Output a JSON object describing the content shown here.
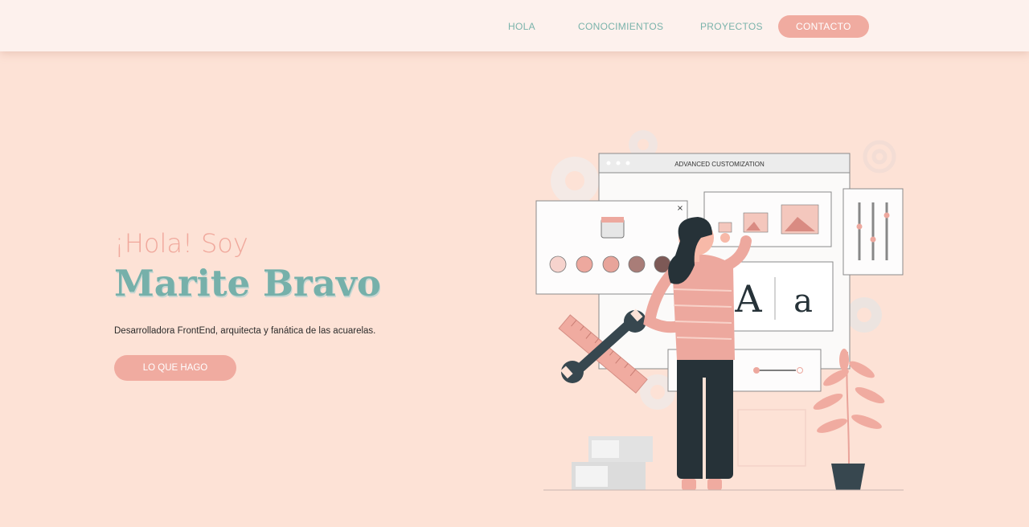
{
  "nav": {
    "items": [
      "HOLA",
      "CONOCIMIENTOS",
      "PROYECTOS"
    ],
    "contact_label": "CONTACTO"
  },
  "hero": {
    "greeting": "¡Hola! Soy",
    "name": "Marite Bravo",
    "description": "Desarrolladora FrontEnd, arquitecta y fanática de las acuarelas.",
    "button_label": "LO QUE HAGO"
  },
  "illustration": {
    "window_title": "ADVANCED CUSTOMIZATION",
    "font_sample_upper": "A",
    "font_sample_lower": "a",
    "close_glyph": "×"
  },
  "colors": {
    "background": "#fde2d6",
    "header": "#fdf1ed",
    "accent_pink": "#f0aba0",
    "accent_teal": "#76b0aa",
    "swatches": [
      "#f6d3cd",
      "#eda89e",
      "#e8a49a",
      "#a97d78",
      "#7d5956"
    ]
  }
}
